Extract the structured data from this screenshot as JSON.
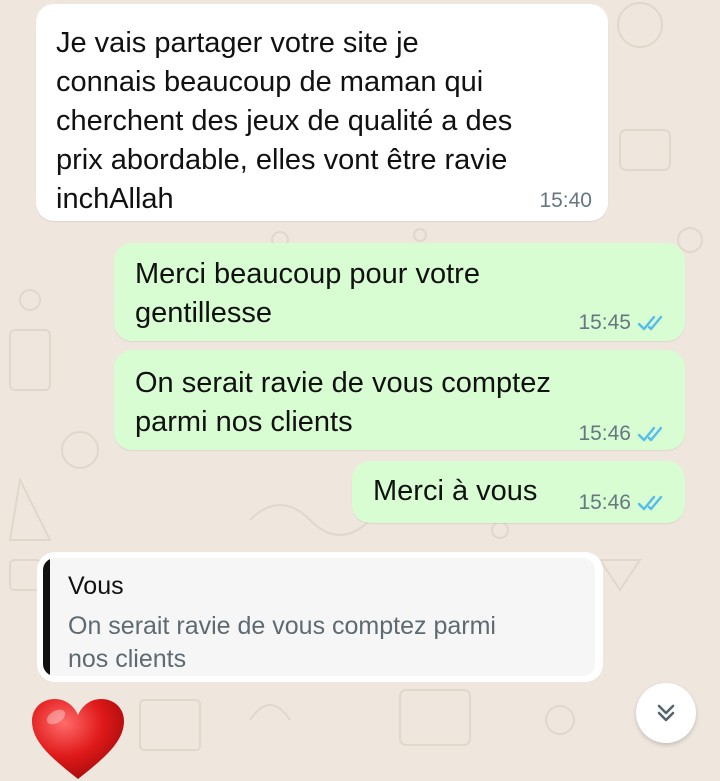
{
  "messages": [
    {
      "direction": "incoming",
      "text": "Je vais partager votre site je\nconnais beaucoup de maman qui\ncherchent des jeux de qualité a des\nprix abordable, elles vont être ravie\ninchAllah",
      "time": "15:40"
    },
    {
      "direction": "outgoing",
      "text": "Merci beaucoup pour votre\ngentillesse",
      "time": "15:45",
      "status": "read"
    },
    {
      "direction": "outgoing",
      "text": "On serait ravie de vous comptez\nparmi nos clients",
      "time": "15:46",
      "status": "read"
    },
    {
      "direction": "outgoing",
      "text": "Merci à vous",
      "time": "15:46",
      "status": "read"
    }
  ],
  "reply_draft": {
    "quoted_author": "Vous",
    "quoted_text": "On serait ravie de vous comptez parmi\nnos clients"
  },
  "reaction_emoji_icon": "red-heart-emoji",
  "scroll_button_icon": "double-chevron-down-icon",
  "colors": {
    "background": "#efe7de",
    "incoming_bubble": "#ffffff",
    "outgoing_bubble": "#d9fdd3",
    "read_ticks": "#53bdeb",
    "timestamp": "#667781"
  }
}
